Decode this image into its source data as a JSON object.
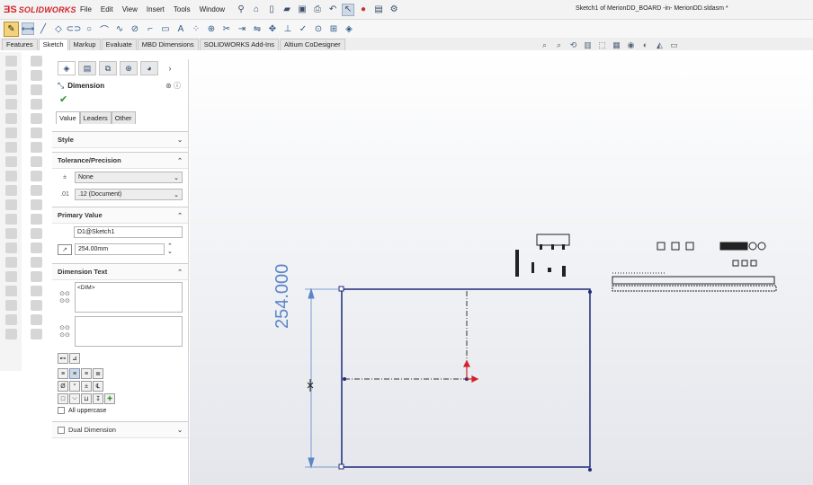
{
  "app": {
    "logo": "SOLIDWORKS",
    "document_title": "Sketch1 of MerionDD_BOARD -in- MerionDD.sldasm *"
  },
  "menu": [
    "File",
    "Edit",
    "View",
    "Insert",
    "Tools",
    "Window"
  ],
  "command_tabs": [
    "Features",
    "Sketch",
    "Markup",
    "Evaluate",
    "MBD Dimensions",
    "SOLIDWORKS Add-Ins",
    "Altium CoDesigner"
  ],
  "active_tab": "Sketch",
  "property_manager": {
    "title": "Dimension",
    "subtabs": [
      "Value",
      "Leaders",
      "Other"
    ],
    "sections": {
      "style": "Style",
      "tolerance": "Tolerance/Precision",
      "primary": "Primary Value",
      "dimtext": "Dimension Text",
      "dual": "Dual Dimension"
    },
    "tolerance_type": "None",
    "precision": ".12 (Document)",
    "primary_name": "D1@Sketch1",
    "primary_value": "254.00mm",
    "dim_text": "<DIM>",
    "all_uppercase": "All uppercase"
  },
  "canvas": {
    "dimension_label": "254.000"
  },
  "colors": {
    "sketch_line": "#1f2a7a",
    "dimension": "#5b86c8",
    "origin": "#d2232a",
    "accent": "#d2232a"
  }
}
